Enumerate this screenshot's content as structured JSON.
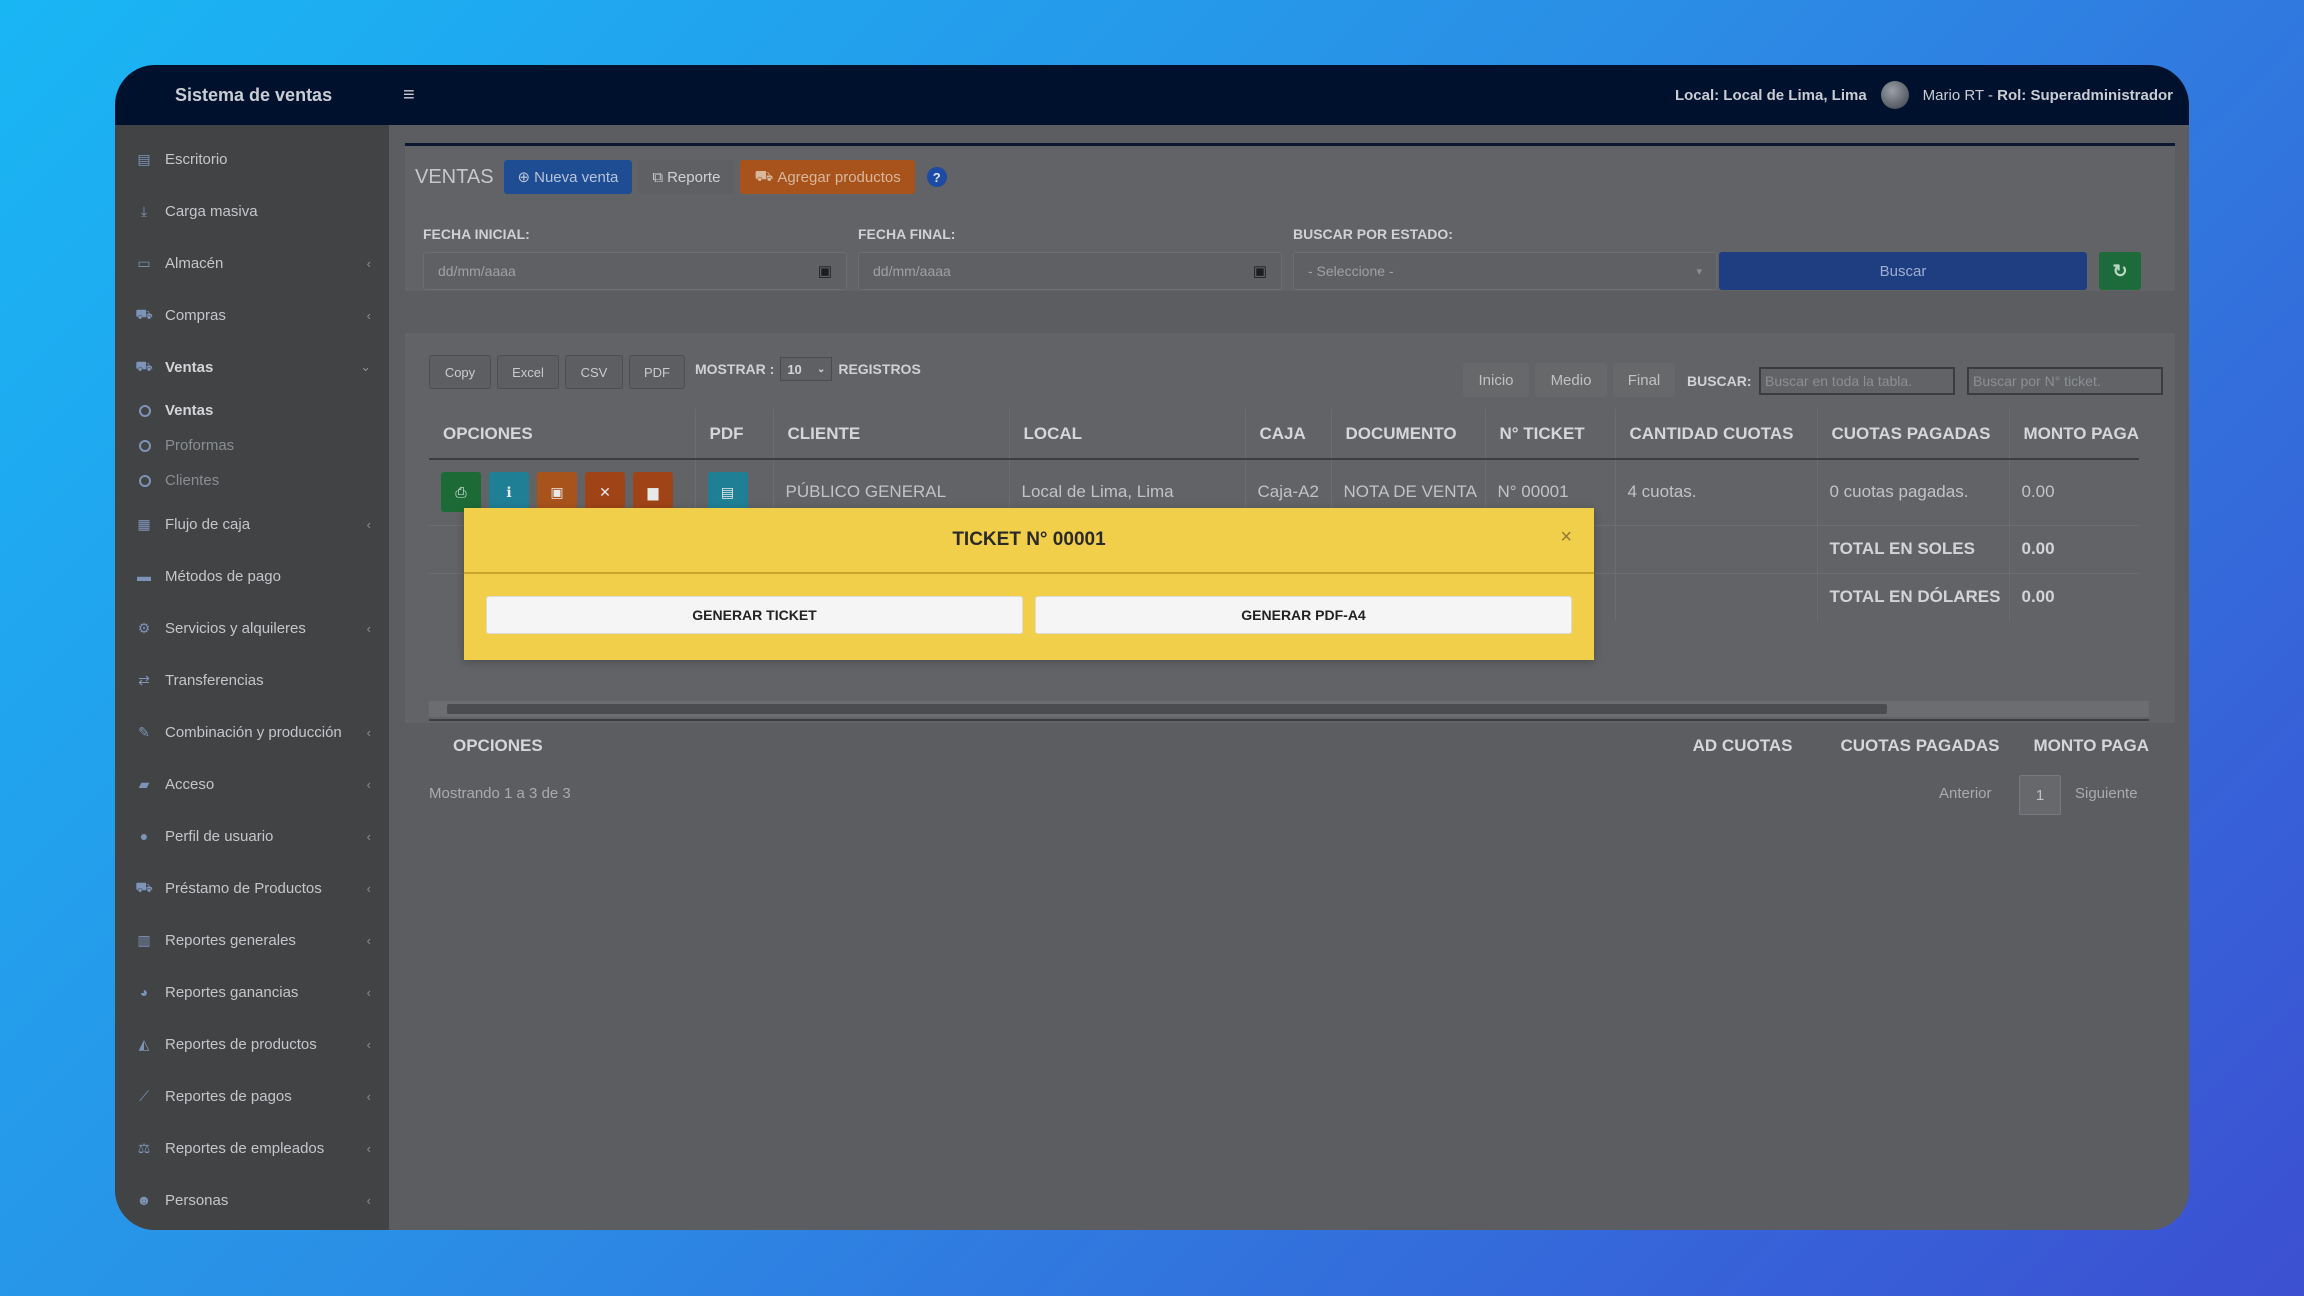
{
  "topbar": {
    "brand": "Sistema de ventas",
    "local_label": "Local: Local de Lima, Lima",
    "user_name": "Mario RT - ",
    "user_role": "Rol: Superadministrador"
  },
  "sidebar": {
    "items": [
      {
        "label": "Escritorio",
        "icon": "desktop-icon",
        "chevron": ""
      },
      {
        "label": "Carga masiva",
        "icon": "download-icon",
        "chevron": ""
      },
      {
        "label": "Almacén",
        "icon": "laptop-icon",
        "chevron": "‹"
      },
      {
        "label": "Compras",
        "icon": "cart-icon",
        "chevron": "‹"
      },
      {
        "label": "Ventas",
        "icon": "cart-icon",
        "chevron": "⌄"
      }
    ],
    "subitems": [
      {
        "label": "Ventas",
        "active": true
      },
      {
        "label": "Proformas",
        "active": false
      },
      {
        "label": "Clientes",
        "active": false
      }
    ],
    "items2": [
      {
        "label": "Flujo de caja",
        "icon": "cash-icon",
        "chevron": "‹"
      },
      {
        "label": "Métodos de pago",
        "icon": "card-icon",
        "chevron": ""
      },
      {
        "label": "Servicios y alquileres",
        "icon": "cogs-icon",
        "chevron": "‹"
      },
      {
        "label": "Transferencias",
        "icon": "transfer-icon",
        "chevron": ""
      },
      {
        "label": "Combinación y producción",
        "icon": "tools-icon",
        "chevron": "‹"
      },
      {
        "label": "Acceso",
        "icon": "folder-icon",
        "chevron": "‹"
      },
      {
        "label": "Perfil de usuario",
        "icon": "user-icon",
        "chevron": "‹"
      },
      {
        "label": "Préstamo de Productos",
        "icon": "truck-icon",
        "chevron": "‹"
      },
      {
        "label": "Reportes generales",
        "icon": "bar-chart-icon",
        "chevron": "‹"
      },
      {
        "label": "Reportes ganancias",
        "icon": "pie-chart-icon",
        "chevron": "‹"
      },
      {
        "label": "Reportes de productos",
        "icon": "area-chart-icon",
        "chevron": "‹"
      },
      {
        "label": "Reportes de pagos",
        "icon": "line-chart-icon",
        "chevron": "‹"
      },
      {
        "label": "Reportes de empleados",
        "icon": "balance-icon",
        "chevron": "‹"
      },
      {
        "label": "Personas",
        "icon": "users-icon",
        "chevron": "‹"
      }
    ]
  },
  "header": {
    "title": "VENTAS",
    "new_sale": "Nueva venta",
    "report": "Reporte",
    "add_products": "Agregar productos",
    "help": "?"
  },
  "filters": {
    "start_label": "FECHA INICIAL:",
    "start_placeholder": "dd/mm/aaaa",
    "end_label": "FECHA FINAL:",
    "end_placeholder": "dd/mm/aaaa",
    "state_label": "BUSCAR POR ESTADO:",
    "state_value": "- Seleccione -",
    "search_btn": "Buscar"
  },
  "table_tools": {
    "copy": "Copy",
    "excel": "Excel",
    "csv": "CSV",
    "pdf": "PDF",
    "show_label": "MOSTRAR :",
    "show_value": "10",
    "records_label": "REGISTROS",
    "inicio": "Inicio",
    "medio": "Medio",
    "final": "Final",
    "search_label": "BUSCAR:",
    "search_all_placeholder": "Buscar en toda la tabla.",
    "search_ticket_placeholder": "Buscar por N° ticket."
  },
  "table": {
    "headers": [
      "OPCIONES",
      "PDF",
      "CLIENTE",
      "LOCAL",
      "CAJA",
      "DOCUMENTO",
      "N° TICKET",
      "CANTIDAD CUOTAS",
      "CUOTAS PAGADAS",
      "MONTO PAGA"
    ],
    "row": {
      "cliente": "PÚBLICO GENERAL",
      "local": "Local de Lima, Lima",
      "caja": "Caja-A2",
      "documento": "NOTA DE VENTA",
      "ticket": "N° 00001",
      "cuotas": "4 cuotas.",
      "pagadas": "0 cuotas pagadas.",
      "monto": "0.00"
    },
    "total_soles_label": "TOTAL EN SOLES",
    "total_soles": "0.00",
    "total_dolares_label": "TOTAL EN DÓLARES",
    "total_dolares": "0.00",
    "footer_headers": [
      "OPCIONES",
      "AD CUOTAS",
      "CUOTAS PAGADAS",
      "MONTO PAGA"
    ]
  },
  "pagination": {
    "info": "Mostrando 1 a 3 de 3",
    "prev": "Anterior",
    "page": "1",
    "next": "Siguiente"
  },
  "modal": {
    "title": "TICKET N° 00001",
    "close": "×",
    "btn_ticket": "GENERAR TICKET",
    "btn_pdf": "GENERAR PDF-A4"
  },
  "colors": {
    "modal_bg": "#f2cf4a",
    "topbar_bg": "#00112e"
  }
}
